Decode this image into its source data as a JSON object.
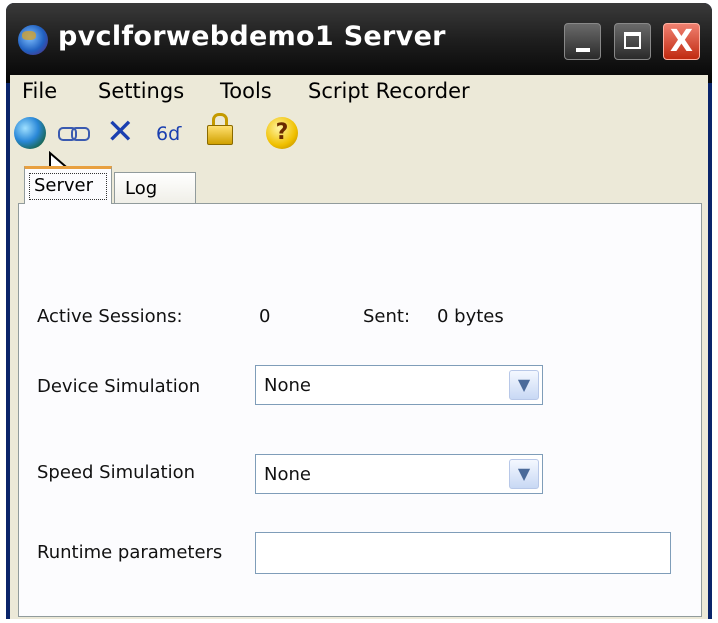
{
  "window": {
    "title": "pvclforwebdemo1 Server",
    "controls": {
      "minimize": "_",
      "maximize": "□",
      "close": "X"
    }
  },
  "menu": [
    "File",
    "Settings",
    "Tools",
    "Script Recorder"
  ],
  "toolbar": {
    "icons": [
      "globe-icon",
      "link-icon",
      "close-icon",
      "glasses-icon",
      "lock-icon",
      "help-icon"
    ],
    "glasses_glyph": "6ɗ",
    "help_glyph": "?"
  },
  "tabs": [
    {
      "label": "Server",
      "selected": true
    },
    {
      "label": "Log",
      "selected": false
    }
  ],
  "server": {
    "active_sessions_label": "Active Sessions:",
    "active_sessions_value": "0",
    "sent_label": "Sent:",
    "sent_value": "0 bytes",
    "device_simulation_label": "Device Simulation",
    "device_simulation_value": "None",
    "speed_simulation_label": "Speed Simulation",
    "speed_simulation_value": "None",
    "runtime_parameters_label": "Runtime parameters",
    "runtime_parameters_value": ""
  },
  "colors": {
    "titlebar": "#1f1f1f",
    "client": "#ece9d8",
    "panel": "#fcfcfe",
    "close_button": "#d84a30",
    "tab_highlight": "#e8a040"
  }
}
